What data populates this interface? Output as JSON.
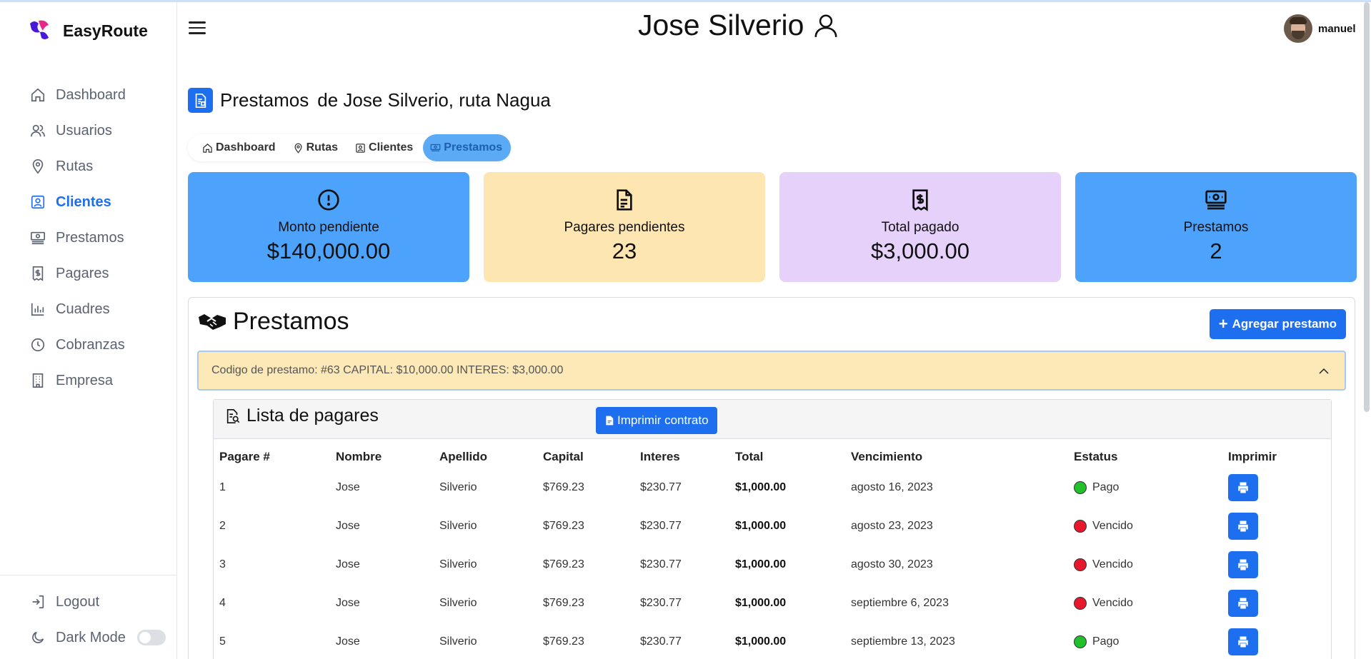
{
  "app": {
    "brand": "EasyRoute"
  },
  "sidebar": {
    "items": [
      {
        "label": "Dashboard",
        "icon": "home-icon"
      },
      {
        "label": "Usuarios",
        "icon": "users-icon"
      },
      {
        "label": "Rutas",
        "icon": "map-pin-icon"
      },
      {
        "label": "Clientes",
        "icon": "contact-icon",
        "active": true
      },
      {
        "label": "Prestamos",
        "icon": "money-icon"
      },
      {
        "label": "Pagares",
        "icon": "receipt-icon"
      },
      {
        "label": "Cuadres",
        "icon": "bar-chart-icon"
      },
      {
        "label": "Cobranzas",
        "icon": "clock-icon"
      },
      {
        "label": "Empresa",
        "icon": "building-icon"
      }
    ],
    "logout": "Logout",
    "dark_mode": "Dark Mode"
  },
  "header": {
    "title": "Jose Silverio",
    "user": "manuel"
  },
  "page": {
    "title": "Prestamos",
    "subtitle": "de Jose Silverio, ruta Nagua"
  },
  "breadcrumb": [
    "Dashboard",
    "Rutas",
    "Clientes",
    "Prestamos"
  ],
  "cards": [
    {
      "label": "Monto pendiente",
      "value": "$140,000.00",
      "color": "#4da3fb"
    },
    {
      "label": "Pagares pendientes",
      "value": "23",
      "color": "#fde6b2"
    },
    {
      "label": "Total pagado",
      "value": "$3,000.00",
      "color": "#e6d1fa"
    },
    {
      "label": "Prestamos",
      "value": "2",
      "color": "#4da3fb"
    }
  ],
  "panel": {
    "title": "Prestamos",
    "add_button": "Agregar prestamo",
    "loan_summary": "Codigo de prestamo: #63 CAPITAL: $10,000.00 INTERES: $3,000.00",
    "list_title": "Lista de pagares",
    "print_contract": "Imprimir contrato"
  },
  "table": {
    "headers": [
      "Pagare #",
      "Nombre",
      "Apellido",
      "Capital",
      "Interes",
      "Total",
      "Vencimiento",
      "Estatus",
      "Imprimir"
    ],
    "rows": [
      {
        "n": "1",
        "nombre": "Jose",
        "apellido": "Silverio",
        "capital": "$769.23",
        "interes": "$230.77",
        "total": "$1,000.00",
        "vence": "agosto 16, 2023",
        "estatus": "Pago",
        "color": "#22c02a"
      },
      {
        "n": "2",
        "nombre": "Jose",
        "apellido": "Silverio",
        "capital": "$769.23",
        "interes": "$230.77",
        "total": "$1,000.00",
        "vence": "agosto 23, 2023",
        "estatus": "Vencido",
        "color": "#e8182c"
      },
      {
        "n": "3",
        "nombre": "Jose",
        "apellido": "Silverio",
        "capital": "$769.23",
        "interes": "$230.77",
        "total": "$1,000.00",
        "vence": "agosto 30, 2023",
        "estatus": "Vencido",
        "color": "#e8182c"
      },
      {
        "n": "4",
        "nombre": "Jose",
        "apellido": "Silverio",
        "capital": "$769.23",
        "interes": "$230.77",
        "total": "$1,000.00",
        "vence": "septiembre 6, 2023",
        "estatus": "Vencido",
        "color": "#e8182c"
      },
      {
        "n": "5",
        "nombre": "Jose",
        "apellido": "Silverio",
        "capital": "$769.23",
        "interes": "$230.77",
        "total": "$1,000.00",
        "vence": "septiembre 13, 2023",
        "estatus": "Pago",
        "color": "#22c02a"
      }
    ]
  }
}
